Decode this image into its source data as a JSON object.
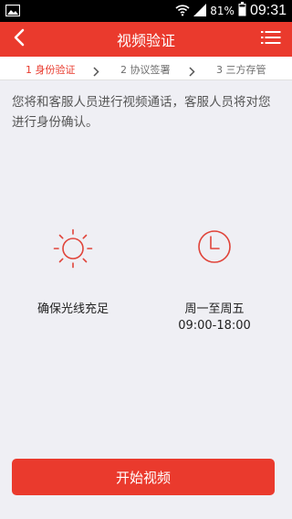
{
  "status_bar": {
    "battery": "81%",
    "time": "09:31",
    "icons": [
      "gallery-icon",
      "wifi-icon",
      "signal-icon",
      "battery-icon"
    ]
  },
  "header": {
    "title": "视频验证",
    "back_icon": "chevron-left-icon",
    "menu_icon": "list-menu-icon"
  },
  "steps": [
    {
      "label": "1 身份验证",
      "active": true
    },
    {
      "label": "2 协议签署",
      "active": false
    },
    {
      "label": "3 三方存管",
      "active": false
    }
  ],
  "intro": "您将和客服人员进行视频通话，客服人员将对您进行身份确认。",
  "features": [
    {
      "icon": "sun-icon",
      "label": "确保光线充足"
    },
    {
      "icon": "clock-icon",
      "label_line1": "周一至周五",
      "label_line2": "09:00-18:00"
    }
  ],
  "start_button": "开始视频",
  "colors": {
    "accent": "#ea3a2d",
    "background": "#efeff4",
    "step_active": "#e8392c"
  }
}
